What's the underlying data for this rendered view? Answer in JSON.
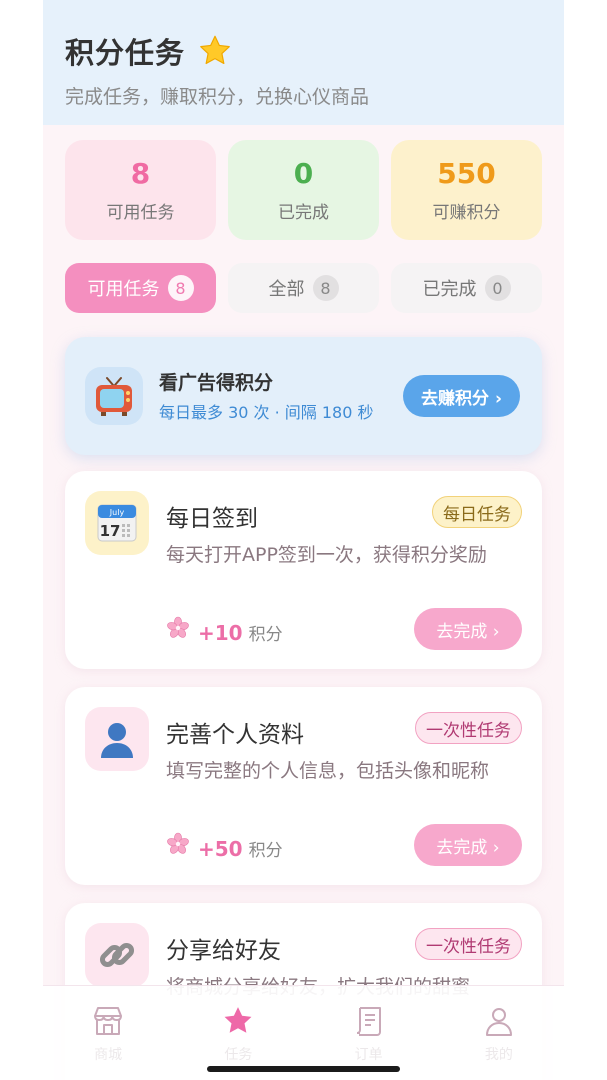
{
  "header": {
    "title": "积分任务",
    "subtitle": "完成任务，赚取积分，兑换心仪商品"
  },
  "stats": [
    {
      "value": "8",
      "label": "可用任务",
      "color": "#f06ba3"
    },
    {
      "value": "0",
      "label": "已完成",
      "color": "#4caf50"
    },
    {
      "value": "550",
      "label": "可赚积分",
      "color": "#ef9a1a"
    }
  ],
  "tabs": [
    {
      "label": "可用任务",
      "count": "8",
      "active": true
    },
    {
      "label": "全部",
      "count": "8",
      "active": false
    },
    {
      "label": "已完成",
      "count": "0",
      "active": false
    }
  ],
  "ad": {
    "title": "看广告得积分",
    "subtitle": "每日最多 30 次 · 间隔 180 秒",
    "button": "去赚积分 ›",
    "icon": "tv-icon"
  },
  "tasks": [
    {
      "name": "每日签到",
      "badge": "每日任务",
      "desc": "每天打开APP签到一次，获得积分奖励",
      "points": "+10",
      "unit": "积分",
      "button": "去完成 ›",
      "icon": "calendar-icon",
      "calendar_month": "July",
      "calendar_day": "17"
    },
    {
      "name": "完善个人资料",
      "badge": "一次性任务",
      "desc": "填写完整的个人信息，包括头像和昵称",
      "points": "+50",
      "unit": "积分",
      "button": "去完成 ›",
      "icon": "user-icon"
    },
    {
      "name": "分享给好友",
      "badge": "一次性任务",
      "desc": "将商城分享给好友，扩大我们的甜蜜",
      "icon": "link-icon"
    }
  ],
  "nav": [
    {
      "label": "商城",
      "icon": "store-icon",
      "active": false
    },
    {
      "label": "任务",
      "icon": "star-icon",
      "active": true
    },
    {
      "label": "订单",
      "icon": "receipt-icon",
      "active": false
    },
    {
      "label": "我的",
      "icon": "profile-icon",
      "active": false
    }
  ],
  "colors": {
    "accent": "#f48fbf",
    "blue": "#5aa5ea",
    "background": "#fdf4f7"
  }
}
